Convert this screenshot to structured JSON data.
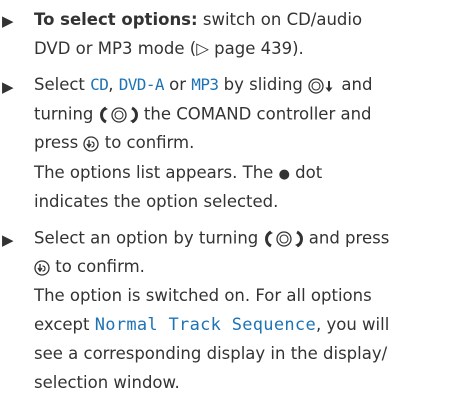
{
  "steps": [
    {
      "lead": "To select options:",
      "line1_rest": " switch on CD/audio",
      "line2_a": "DVD or MP3 mode (",
      "page_ref_glyph": "▷",
      "line2_b": " page 439)."
    },
    {
      "select_word": "Select ",
      "option_cd": "CD",
      "sep1": ", ",
      "option_dvd": "DVD-A",
      "sep2": " or ",
      "option_mp3": "MP3",
      "by_sliding": " by sliding ",
      "and": " and",
      "turning": "turning ",
      "controller_text": " the COMAND controller and",
      "press": "press ",
      "to_confirm": " to confirm.",
      "result1": "The options list appears. The",
      "dot_glyph": "●",
      "result1_tail": "dot",
      "result2": "indicates the option selected."
    },
    {
      "line1_a": "Select an option by turning ",
      "line1_b": " and press",
      "to_confirm": " to confirm.",
      "result1": "The option is switched on. For all options",
      "result2_a": "except ",
      "normal_track": "Normal Track Sequence",
      "result2_b": ", you will",
      "result3": "see a corresponding display in the display/",
      "result4": "selection window."
    }
  ],
  "bullet_glyph": "▶",
  "colors": {
    "text": "#333333",
    "highlight": "#1e73b5"
  },
  "icons": {
    "slide": "slide-down-icon",
    "turn": "turn-controller-icon",
    "press": "press-controller-icon"
  }
}
